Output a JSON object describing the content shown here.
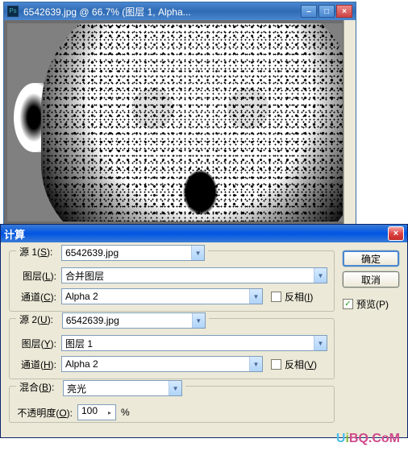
{
  "docWindow": {
    "title": "6542639.jpg @ 66.7% (图层 1, Alpha...",
    "appIcon": "Ps"
  },
  "dialog": {
    "title": "计算",
    "buttons": {
      "ok": "确定",
      "cancel": "取消",
      "preview": "预览(P)"
    },
    "source1": {
      "legendPrefix": "源 1(",
      "legendKey": "S",
      "legendSuffix": "):",
      "file": "6542639.jpg",
      "layerLabelPrefix": "图层(",
      "layerLabelKey": "L",
      "layerLabelSuffix": "):",
      "layer": "合并图层",
      "channelLabelPrefix": "通道(",
      "channelLabelKey": "C",
      "channelLabelSuffix": "):",
      "channel": "Alpha 2",
      "invertPrefix": "反相(",
      "invertKey": "I",
      "invertSuffix": ")"
    },
    "source2": {
      "legendPrefix": "源 2(",
      "legendKey": "U",
      "legendSuffix": "):",
      "file": "6542639.jpg",
      "layerLabelPrefix": "图层(",
      "layerLabelKey": "Y",
      "layerLabelSuffix": "):",
      "layer": "图层 1",
      "channelLabelPrefix": "通道(",
      "channelLabelKey": "H",
      "channelLabelSuffix": "):",
      "channel": "Alpha 2",
      "invertPrefix": "反相(",
      "invertKey": "V",
      "invertSuffix": ")"
    },
    "blend": {
      "labelPrefix": "混合(",
      "labelKey": "B",
      "labelSuffix": "):",
      "mode": "亮光",
      "opacityLabelPrefix": "不透明度(",
      "opacityLabelKey": "O",
      "opacityLabelSuffix": "):",
      "opacity": "100",
      "percent": "%"
    }
  },
  "watermark": {
    "u": "U",
    "i": "i",
    "rest": "BQ.CoM"
  }
}
